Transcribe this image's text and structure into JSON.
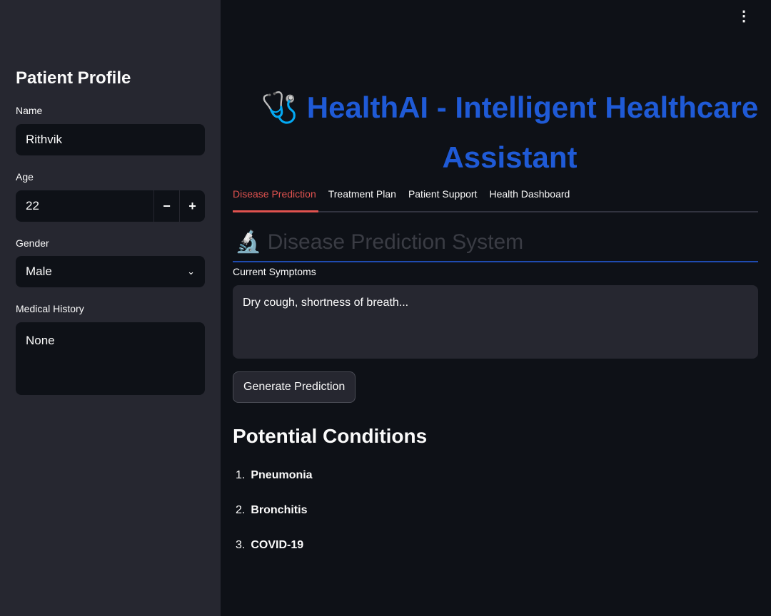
{
  "sidebar": {
    "title": "Patient Profile",
    "name_label": "Name",
    "name_value": "Rithvik",
    "age_label": "Age",
    "age_value": "22",
    "minus": "−",
    "plus": "+",
    "gender_label": "Gender",
    "gender_value": "Male",
    "history_label": "Medical History",
    "history_value": "None"
  },
  "header": {
    "title": "🩺 HealthAI - Intelligent Healthcare Assistant",
    "menu": "⋮"
  },
  "tabs": [
    {
      "label": "Disease Prediction",
      "active": true
    },
    {
      "label": "Treatment Plan"
    },
    {
      "label": "Patient Support"
    },
    {
      "label": "Health Dashboard"
    }
  ],
  "section": {
    "title": "🔬 Disease Prediction System",
    "symptoms_label": "Current Symptoms",
    "symptoms_value": "Dry cough, shortness of breath...",
    "button": "Generate Prediction",
    "results_title": "Potential Conditions",
    "conditions": [
      "Pneumonia",
      "Bronchitis",
      "COVID-19"
    ]
  },
  "colors": {
    "accent": "#1f5ad6",
    "active_tab": "#e0524f"
  }
}
